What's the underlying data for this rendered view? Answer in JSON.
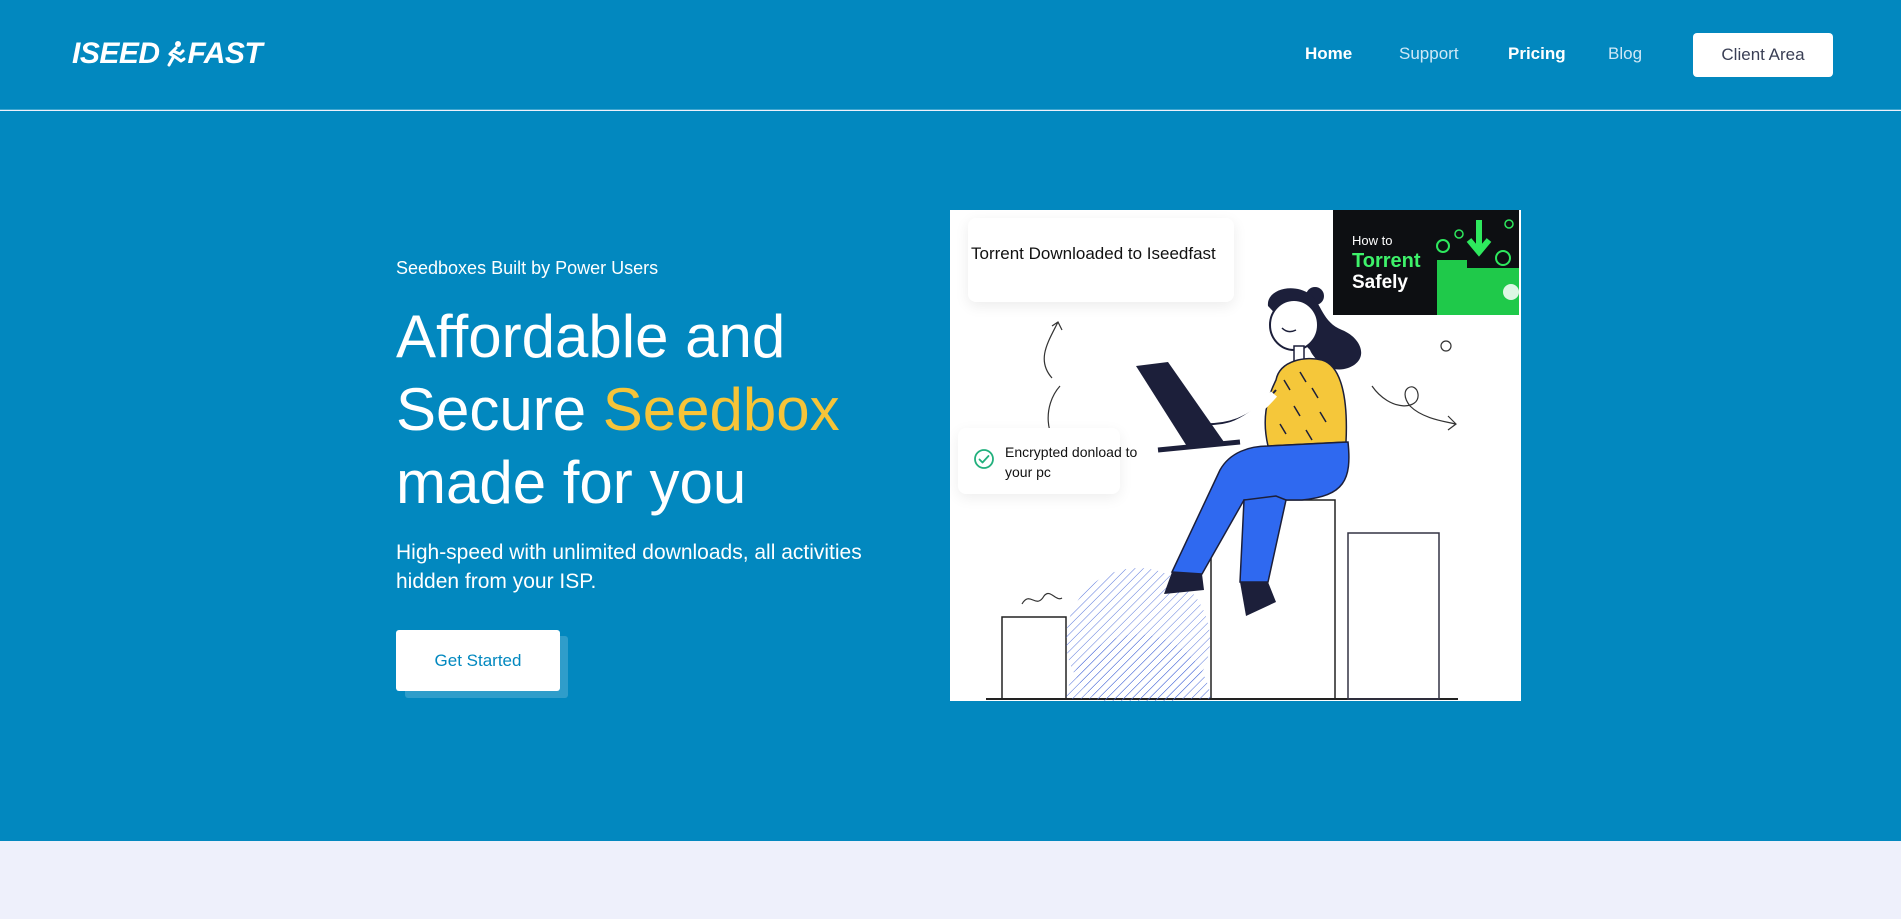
{
  "header": {
    "logo_left": "ISEED",
    "logo_right": "FAST",
    "nav": [
      {
        "label": "Home"
      },
      {
        "label": "Support"
      },
      {
        "label": "Pricing"
      },
      {
        "label": "Blog"
      }
    ],
    "client_area_label": "Client Area"
  },
  "hero": {
    "eyebrow": "Seedboxes Built by Power Users",
    "headline_line1": "Affordable and",
    "headline_line2_prefix": "Secure ",
    "headline_accent": "Seedbox",
    "headline_line3": "made for you",
    "subhead": "High-speed with unlimited downloads, all activities hidden from your ISP.",
    "cta_label": "Get Started"
  },
  "illustration": {
    "card_top_text": "Torrent Downloaded to Iseedfast",
    "card_check_text": "Encrypted donload to your pc",
    "thumb_line1": "How to",
    "thumb_line2": "Torrent",
    "thumb_line3": "Safely"
  },
  "colors": {
    "brand": "#0288bf",
    "accent": "#f6c439",
    "white": "#ffffff"
  }
}
